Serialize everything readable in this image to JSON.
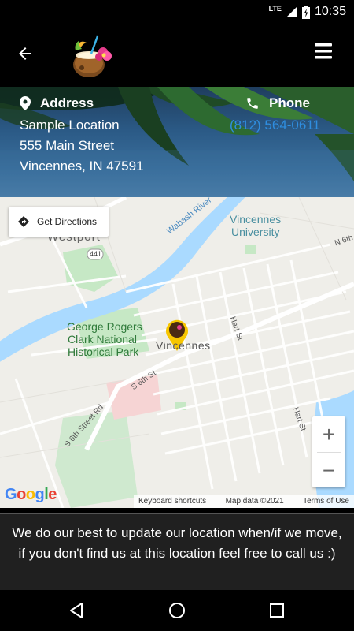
{
  "status_bar": {
    "network": "LTE",
    "time": "10:35"
  },
  "app_bar": {
    "back_icon": "arrow-left-icon",
    "logo": "coconut-drink-logo",
    "menu_icon": "hamburger-menu-icon"
  },
  "info": {
    "address_heading": "Address",
    "address_lines": [
      "Sample Location",
      "555 Main Street",
      "Vincennes, IN 47591"
    ],
    "phone_heading": "Phone",
    "phone_number": "(812) 564-0611"
  },
  "map": {
    "get_directions_label": "Get Directions",
    "labels": {
      "westport": "Westport",
      "route_441": "441",
      "wabash_river": "Wabash River",
      "vincennes_university_1": "Vincennes",
      "vincennes_university_2": "University",
      "n6th": "N 6th",
      "park_1": "George Rogers",
      "park_2": "Clark National",
      "park_3": "Historical Park",
      "city": "Vincennes",
      "hart_st_1": "Hart St",
      "hart_st_2": "Hart St",
      "s6th_st": "S 6th St",
      "s6th_street_rd": "S 6th Street Rd"
    },
    "zoom_in": "+",
    "zoom_out": "−",
    "google_logo": "Google",
    "keyboard_shortcuts": "Keyboard shortcuts",
    "map_data": "Map data ©2021",
    "terms": "Terms of Use"
  },
  "notice": "We do our best to update our location when/if we move, if you don't find us at this location feel free to call us :)",
  "colors": {
    "phone_link": "#2f8ee0",
    "river": "#aadaff",
    "park": "#c6e8c5",
    "marker": "#f7c600"
  }
}
